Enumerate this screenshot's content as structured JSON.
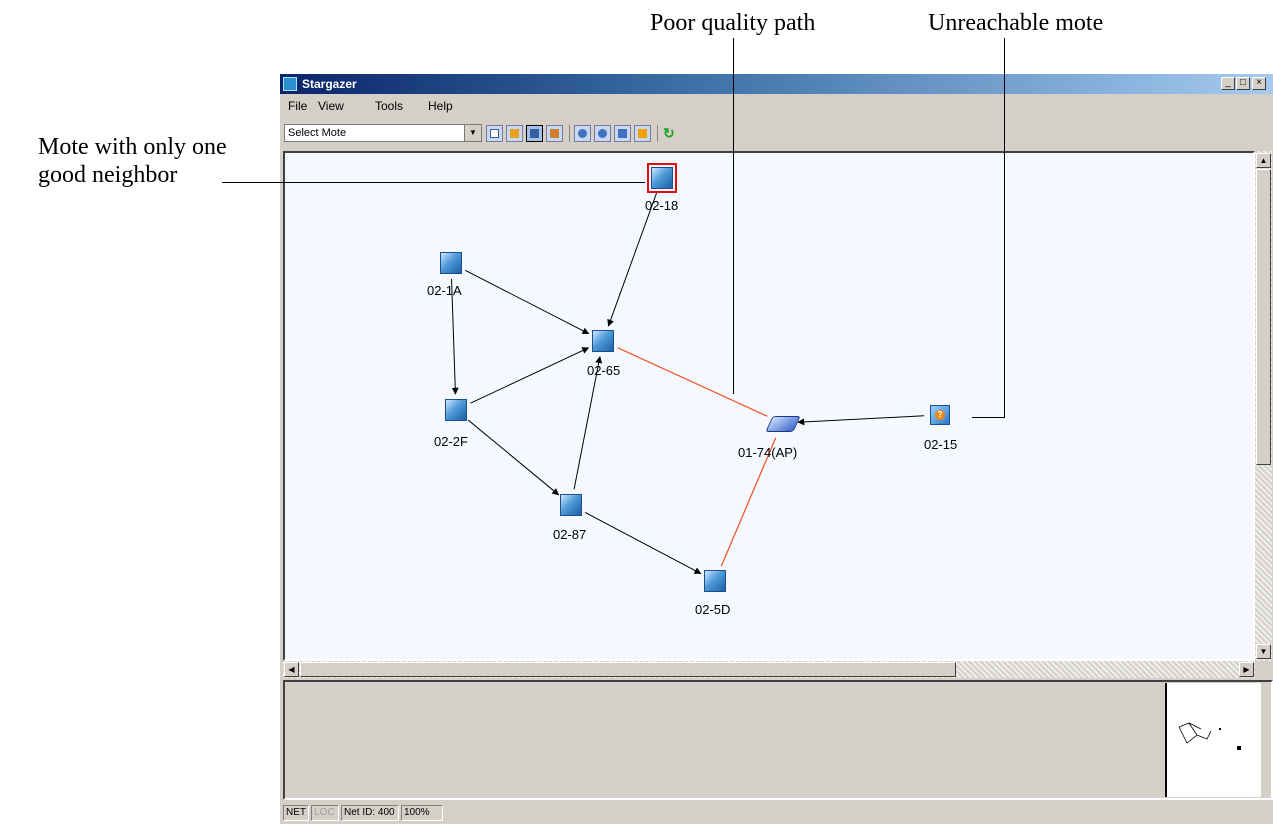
{
  "annotations": {
    "poor_quality_path": "Poor quality path",
    "unreachable_mote": "Unreachable mote",
    "one_good_neighbor_line1": "Mote with only one",
    "one_good_neighbor_line2": "good neighbor"
  },
  "window": {
    "title": "Stargazer",
    "controls": {
      "minimize": "_",
      "maximize": "□",
      "close": "×"
    }
  },
  "menu": {
    "items": [
      "File",
      "View",
      "Tools",
      "Help"
    ]
  },
  "toolbar": {
    "select_placeholder": "Select Mote",
    "select_arrow": "▼",
    "refresh_glyph": "↻"
  },
  "network": {
    "nodes": [
      {
        "id": "02-18",
        "label": "02-18",
        "kind": "mote",
        "selected": true
      },
      {
        "id": "02-1A",
        "label": "02-1A",
        "kind": "mote"
      },
      {
        "id": "02-65",
        "label": "02-65",
        "kind": "mote"
      },
      {
        "id": "02-2F",
        "label": "02-2F",
        "kind": "mote"
      },
      {
        "id": "01-74",
        "label": "01-74(AP)",
        "kind": "access-point"
      },
      {
        "id": "02-15",
        "label": "02-15",
        "kind": "unreachable"
      },
      {
        "id": "02-87",
        "label": "02-87",
        "kind": "mote"
      },
      {
        "id": "02-5D",
        "label": "02-5D",
        "kind": "mote"
      }
    ],
    "links": [
      {
        "from": "02-18",
        "to": "02-65",
        "quality": "good"
      },
      {
        "from": "02-1A",
        "to": "02-65",
        "quality": "good"
      },
      {
        "from": "02-1A",
        "to": "02-2F",
        "quality": "good"
      },
      {
        "from": "02-2F",
        "to": "02-65",
        "quality": "good"
      },
      {
        "from": "02-2F",
        "to": "02-87",
        "quality": "good"
      },
      {
        "from": "02-87",
        "to": "02-65",
        "quality": "good"
      },
      {
        "from": "02-87",
        "to": "02-5D",
        "quality": "good"
      },
      {
        "from": "02-15",
        "to": "01-74",
        "quality": "good"
      },
      {
        "from": "02-65",
        "to": "01-74",
        "quality": "poor"
      },
      {
        "from": "02-5D",
        "to": "01-74",
        "quality": "poor"
      }
    ],
    "poor_link_color": "#f05a2a",
    "good_link_color": "#000000"
  },
  "statusbar": {
    "panels": [
      "NET",
      "LOC",
      "Net ID: 400",
      "100%"
    ]
  },
  "scrollbar": {
    "up": "▲",
    "down": "▼",
    "left": "◀",
    "right": "▶"
  }
}
